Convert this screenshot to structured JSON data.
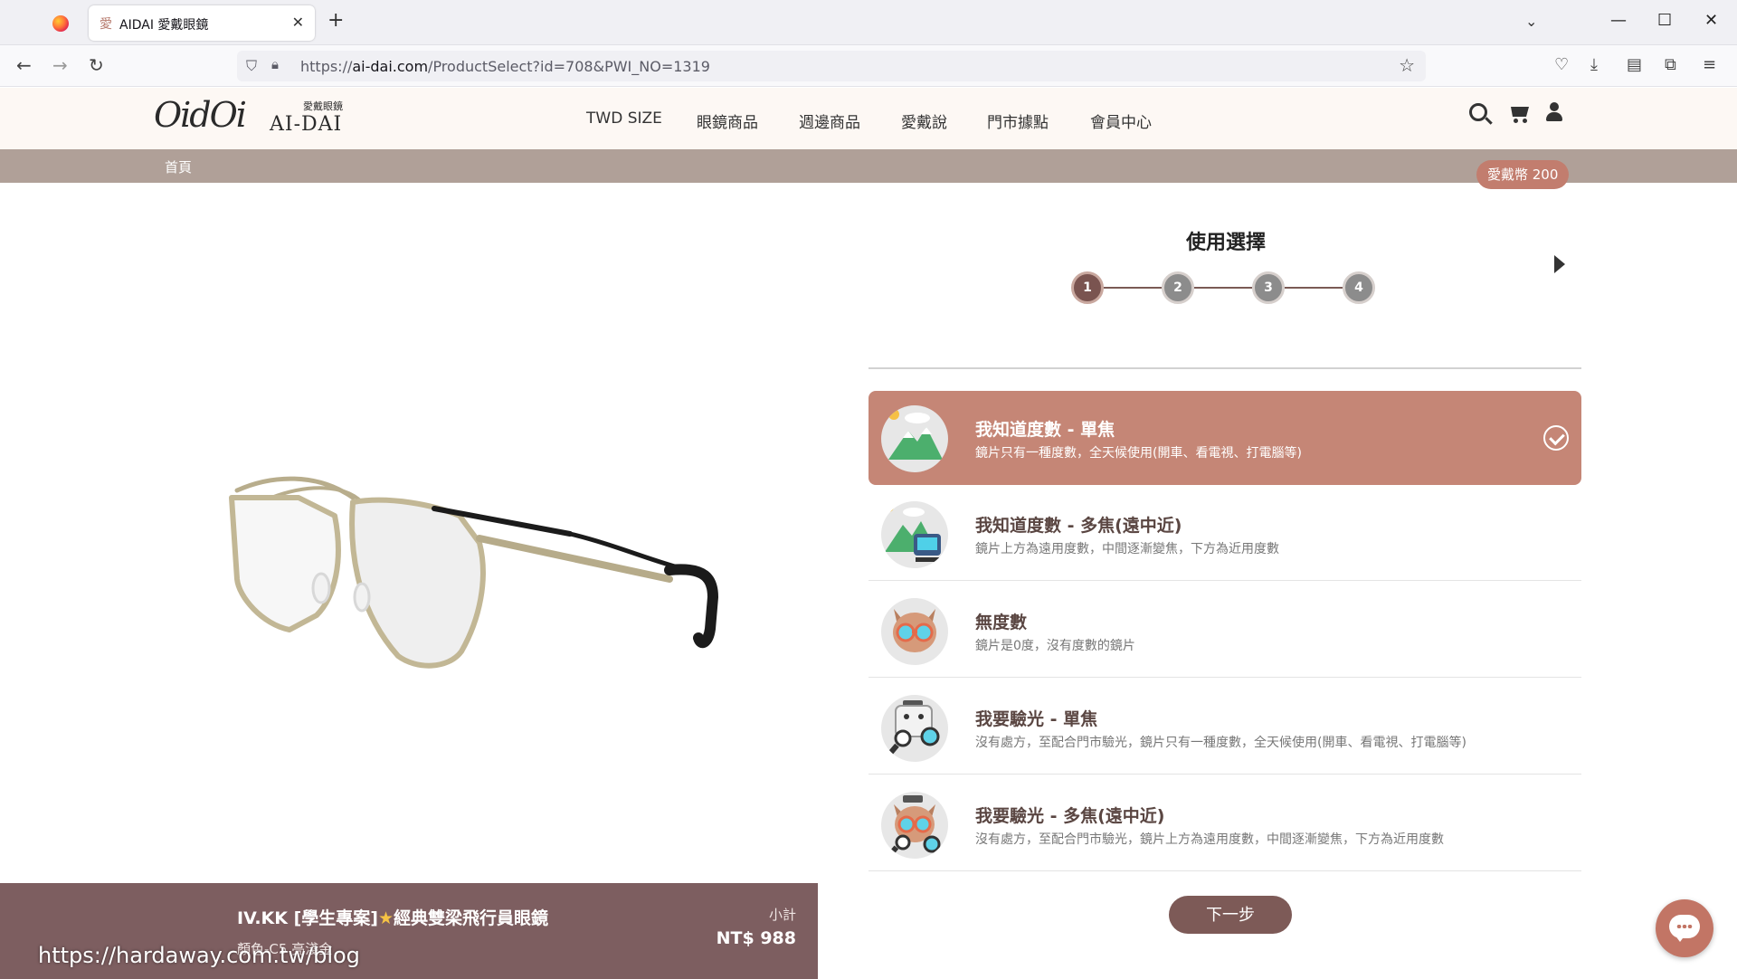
{
  "browser": {
    "tab_title": "AIDAI 愛戴眼鏡",
    "tab_favicon": "愛",
    "url_host": "ai-dai.com",
    "url_prefix": "https://",
    "url_path": "/ProductSelect?id=708&PWI_NO=1319"
  },
  "header": {
    "logo_script": "OidOi",
    "logo_cn": "愛戴眼鏡",
    "logo_en": "AI-DAI",
    "nav": [
      "TWD SIZE",
      "眼鏡商品",
      "週邊商品",
      "愛戴說",
      "門市據點",
      "會員中心"
    ]
  },
  "breadcrumb": {
    "home": "首頁"
  },
  "coin_badge": "愛戴幣 200",
  "panel": {
    "title": "使用選擇",
    "steps": [
      "1",
      "2",
      "3",
      "4"
    ],
    "active_step": 1
  },
  "options": [
    {
      "title": "我知道度數 - 單焦",
      "desc": "鏡片只有一種度數，全天候使用(開車、看電視、打電腦等)",
      "icon": "mountain-icon",
      "selected": true
    },
    {
      "title": "我知道度數 - 多焦(遠中近)",
      "desc": "鏡片上方為遠用度數，中間逐漸變焦，下方為近用度數",
      "icon": "mountain-computer-icon",
      "selected": false
    },
    {
      "title": "無度數",
      "desc": "鏡片是0度，沒有度數的鏡片",
      "icon": "glasses-face-icon",
      "selected": false
    },
    {
      "title": "我要驗光 - 單焦",
      "desc": "沒有處方，至配合門市驗光，鏡片只有一種度數，全天候使用(開車、看電視、打電腦等)",
      "icon": "eye-exam-icon",
      "selected": false
    },
    {
      "title": "我要驗光 - 多焦(遠中近)",
      "desc": "沒有處方，至配合門市驗光，鏡片上方為遠用度數，中間逐漸變焦，下方為近用度數",
      "icon": "eye-exam-glasses-icon",
      "selected": false
    }
  ],
  "next_button": "下一步",
  "product": {
    "name": "IV.KK [學生專案]",
    "name_star": "★",
    "name_rest": "經典雙梁飛行員眼鏡",
    "color": "顏色-C5 亮淺金",
    "subtotal_label": "小計",
    "price": "NT$ 988"
  },
  "watermark": "https://hardaway.com.tw/blog",
  "colors": {
    "accent": "#c58676",
    "brand_dark": "#7d5a57",
    "crumb_bar": "#b0a098",
    "header_bg": "#fdf8f4"
  }
}
